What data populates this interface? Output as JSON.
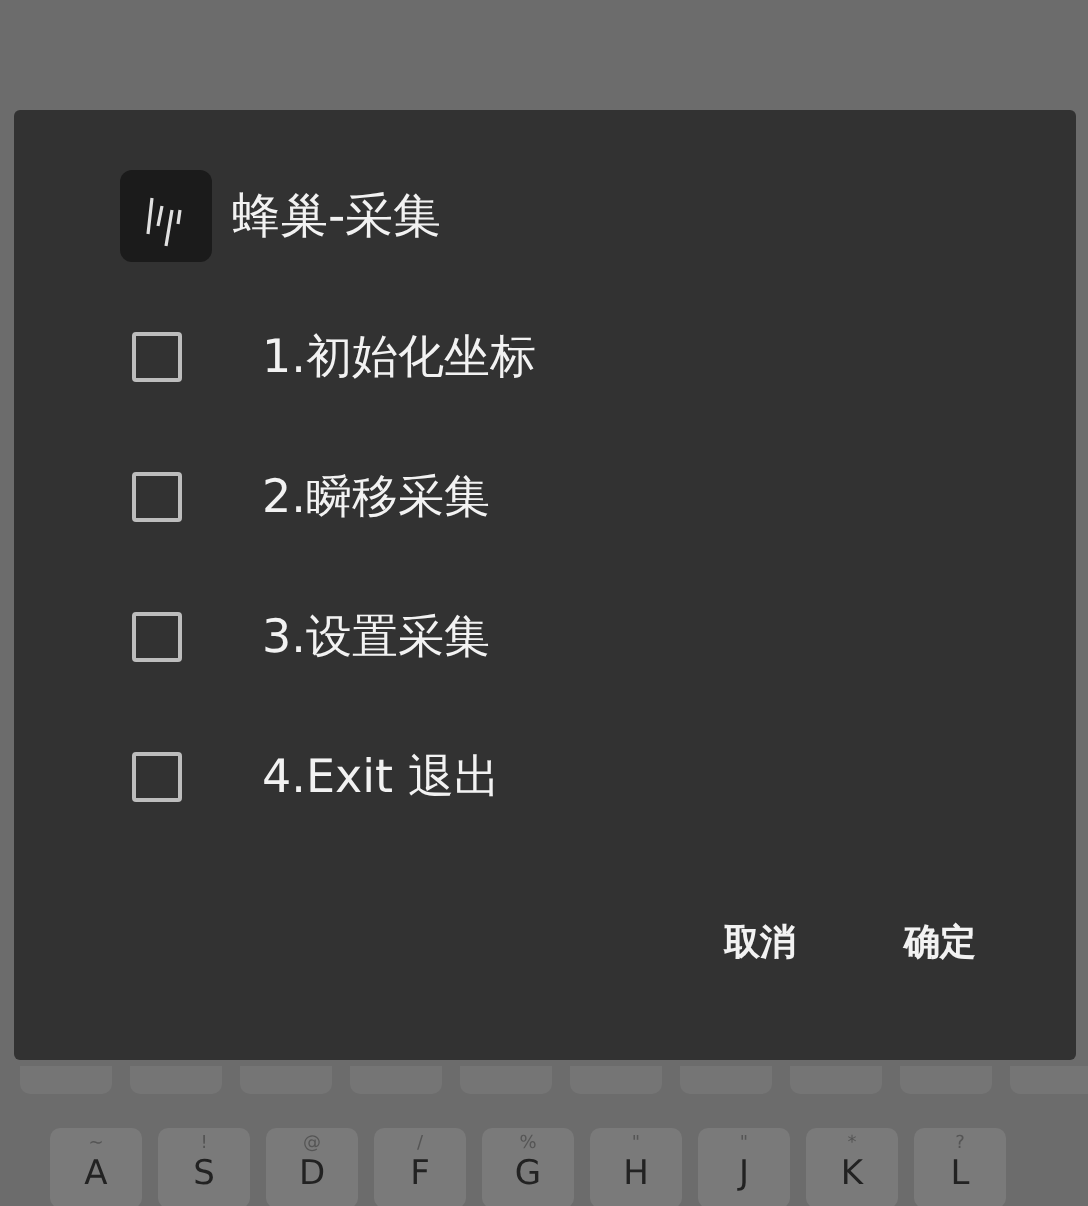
{
  "dialog": {
    "title": "蜂巢-采集",
    "options": [
      {
        "label": "1.初始化坐标",
        "checked": false
      },
      {
        "label": "2.瞬移采集",
        "checked": false
      },
      {
        "label": "3.设置采集",
        "checked": false
      },
      {
        "label": "4.Exit 退出",
        "checked": false
      }
    ],
    "buttons": [
      "取消",
      "确定"
    ]
  },
  "keyboard": {
    "keys": [
      {
        "symbol": "~",
        "letter": "A"
      },
      {
        "symbol": "!",
        "letter": "S"
      },
      {
        "symbol": "@",
        "letter": "D"
      },
      {
        "symbol": "/",
        "letter": "F"
      },
      {
        "symbol": "%",
        "letter": "G"
      },
      {
        "symbol": "\"",
        "letter": "H"
      },
      {
        "symbol": "\"",
        "letter": "J"
      },
      {
        "symbol": "*",
        "letter": "K"
      },
      {
        "symbol": "?",
        "letter": "L"
      }
    ]
  }
}
